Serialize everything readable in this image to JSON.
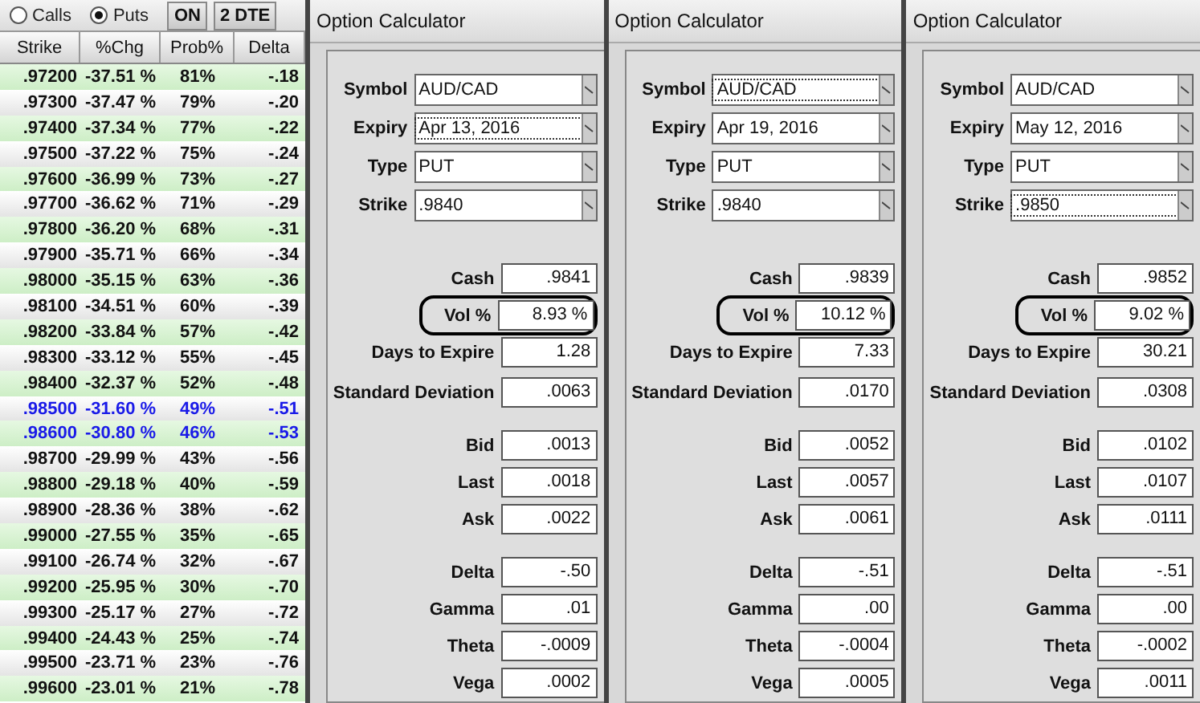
{
  "toolbar": {
    "radios": [
      {
        "label": "Calls",
        "selected": false
      },
      {
        "label": "Puts",
        "selected": true
      }
    ],
    "buttons": [
      "ON",
      "2 DTE"
    ]
  },
  "table": {
    "columns": [
      "Strike",
      "%Chg",
      "Prob%",
      "Delta"
    ],
    "rows": [
      {
        "cells": [
          ".97200",
          "-37.51 %",
          "81%",
          "-.18"
        ],
        "highlighted": false
      },
      {
        "cells": [
          ".97300",
          "-37.47 %",
          "79%",
          "-.20"
        ],
        "highlighted": false
      },
      {
        "cells": [
          ".97400",
          "-37.34 %",
          "77%",
          "-.22"
        ],
        "highlighted": false
      },
      {
        "cells": [
          ".97500",
          "-37.22 %",
          "75%",
          "-.24"
        ],
        "highlighted": false
      },
      {
        "cells": [
          ".97600",
          "-36.99 %",
          "73%",
          "-.27"
        ],
        "highlighted": false
      },
      {
        "cells": [
          ".97700",
          "-36.62 %",
          "71%",
          "-.29"
        ],
        "highlighted": false
      },
      {
        "cells": [
          ".97800",
          "-36.20 %",
          "68%",
          "-.31"
        ],
        "highlighted": false
      },
      {
        "cells": [
          ".97900",
          "-35.71 %",
          "66%",
          "-.34"
        ],
        "highlighted": false
      },
      {
        "cells": [
          ".98000",
          "-35.15 %",
          "63%",
          "-.36"
        ],
        "highlighted": false
      },
      {
        "cells": [
          ".98100",
          "-34.51 %",
          "60%",
          "-.39"
        ],
        "highlighted": false
      },
      {
        "cells": [
          ".98200",
          "-33.84 %",
          "57%",
          "-.42"
        ],
        "highlighted": false
      },
      {
        "cells": [
          ".98300",
          "-33.12 %",
          "55%",
          "-.45"
        ],
        "highlighted": false
      },
      {
        "cells": [
          ".98400",
          "-32.37 %",
          "52%",
          "-.48"
        ],
        "highlighted": false
      },
      {
        "cells": [
          ".98500",
          "-31.60 %",
          "49%",
          "-.51"
        ],
        "highlighted": true
      },
      {
        "cells": [
          ".98600",
          "-30.80 %",
          "46%",
          "-.53"
        ],
        "highlighted": true
      },
      {
        "cells": [
          ".98700",
          "-29.99 %",
          "43%",
          "-.56"
        ],
        "highlighted": false
      },
      {
        "cells": [
          ".98800",
          "-29.18 %",
          "40%",
          "-.59"
        ],
        "highlighted": false
      },
      {
        "cells": [
          ".98900",
          "-28.36 %",
          "38%",
          "-.62"
        ],
        "highlighted": false
      },
      {
        "cells": [
          ".99000",
          "-27.55 %",
          "35%",
          "-.65"
        ],
        "highlighted": false
      },
      {
        "cells": [
          ".99100",
          "-26.74 %",
          "32%",
          "-.67"
        ],
        "highlighted": false
      },
      {
        "cells": [
          ".99200",
          "-25.95 %",
          "30%",
          "-.70"
        ],
        "highlighted": false
      },
      {
        "cells": [
          ".99300",
          "-25.17 %",
          "27%",
          "-.72"
        ],
        "highlighted": false
      },
      {
        "cells": [
          ".99400",
          "-24.43 %",
          "25%",
          "-.74"
        ],
        "highlighted": false
      },
      {
        "cells": [
          ".99500",
          "-23.71 %",
          "23%",
          "-.76"
        ],
        "highlighted": false
      },
      {
        "cells": [
          ".99600",
          "-23.01 %",
          "21%",
          "-.78"
        ],
        "highlighted": false
      }
    ]
  },
  "calculators": [
    {
      "title": "Option Calculator",
      "dropdowns": [
        {
          "label": "Symbol",
          "value": "AUD/CAD",
          "focused": false
        },
        {
          "label": "Expiry",
          "value": "Apr 13, 2016",
          "focused": true
        },
        {
          "label": "Type",
          "value": "PUT",
          "focused": false
        },
        {
          "label": "Strike",
          "value": ".9840",
          "focused": false
        }
      ],
      "groups": [
        [
          {
            "label": "Cash",
            "value": ".9841",
            "circled": false
          },
          {
            "label": "Vol %",
            "value": "8.93 %",
            "circled": true
          },
          {
            "label": "Days to Expire",
            "value": "1.28",
            "circled": false
          }
        ],
        [
          {
            "label": "Standard Deviation",
            "value": ".0063",
            "circled": false
          }
        ],
        [
          {
            "label": "Bid",
            "value": ".0013",
            "circled": false
          },
          {
            "label": "Last",
            "value": ".0018",
            "circled": false
          },
          {
            "label": "Ask",
            "value": ".0022",
            "circled": false
          }
        ],
        [
          {
            "label": "Delta",
            "value": "-.50",
            "circled": false
          },
          {
            "label": "Gamma",
            "value": ".01",
            "circled": false
          },
          {
            "label": "Theta",
            "value": "-.0009",
            "circled": false
          },
          {
            "label": "Vega",
            "value": ".0002",
            "circled": false
          }
        ]
      ]
    },
    {
      "title": "Option Calculator",
      "dropdowns": [
        {
          "label": "Symbol",
          "value": "AUD/CAD",
          "focused": true
        },
        {
          "label": "Expiry",
          "value": "Apr 19, 2016",
          "focused": false
        },
        {
          "label": "Type",
          "value": "PUT",
          "focused": false
        },
        {
          "label": "Strike",
          "value": ".9840",
          "focused": false
        }
      ],
      "groups": [
        [
          {
            "label": "Cash",
            "value": ".9839",
            "circled": false
          },
          {
            "label": "Vol %",
            "value": "10.12 %",
            "circled": true
          },
          {
            "label": "Days to Expire",
            "value": "7.33",
            "circled": false
          }
        ],
        [
          {
            "label": "Standard Deviation",
            "value": ".0170",
            "circled": false
          }
        ],
        [
          {
            "label": "Bid",
            "value": ".0052",
            "circled": false
          },
          {
            "label": "Last",
            "value": ".0057",
            "circled": false
          },
          {
            "label": "Ask",
            "value": ".0061",
            "circled": false
          }
        ],
        [
          {
            "label": "Delta",
            "value": "-.51",
            "circled": false
          },
          {
            "label": "Gamma",
            "value": ".00",
            "circled": false
          },
          {
            "label": "Theta",
            "value": "-.0004",
            "circled": false
          },
          {
            "label": "Vega",
            "value": ".0005",
            "circled": false
          }
        ]
      ]
    },
    {
      "title": "Option Calculator",
      "dropdowns": [
        {
          "label": "Symbol",
          "value": "AUD/CAD",
          "focused": false
        },
        {
          "label": "Expiry",
          "value": "May 12, 2016",
          "focused": false
        },
        {
          "label": "Type",
          "value": "PUT",
          "focused": false
        },
        {
          "label": "Strike",
          "value": ".9850",
          "focused": true
        }
      ],
      "groups": [
        [
          {
            "label": "Cash",
            "value": ".9852",
            "circled": false
          },
          {
            "label": "Vol %",
            "value": "9.02 %",
            "circled": true
          },
          {
            "label": "Days to Expire",
            "value": "30.21",
            "circled": false
          }
        ],
        [
          {
            "label": "Standard Deviation",
            "value": ".0308",
            "circled": false
          }
        ],
        [
          {
            "label": "Bid",
            "value": ".0102",
            "circled": false
          },
          {
            "label": "Last",
            "value": ".0107",
            "circled": false
          },
          {
            "label": "Ask",
            "value": ".0111",
            "circled": false
          }
        ],
        [
          {
            "label": "Delta",
            "value": "-.51",
            "circled": false
          },
          {
            "label": "Gamma",
            "value": ".00",
            "circled": false
          },
          {
            "label": "Theta",
            "value": "-.0002",
            "circled": false
          },
          {
            "label": "Vega",
            "value": ".0011",
            "circled": false
          }
        ]
      ]
    }
  ]
}
